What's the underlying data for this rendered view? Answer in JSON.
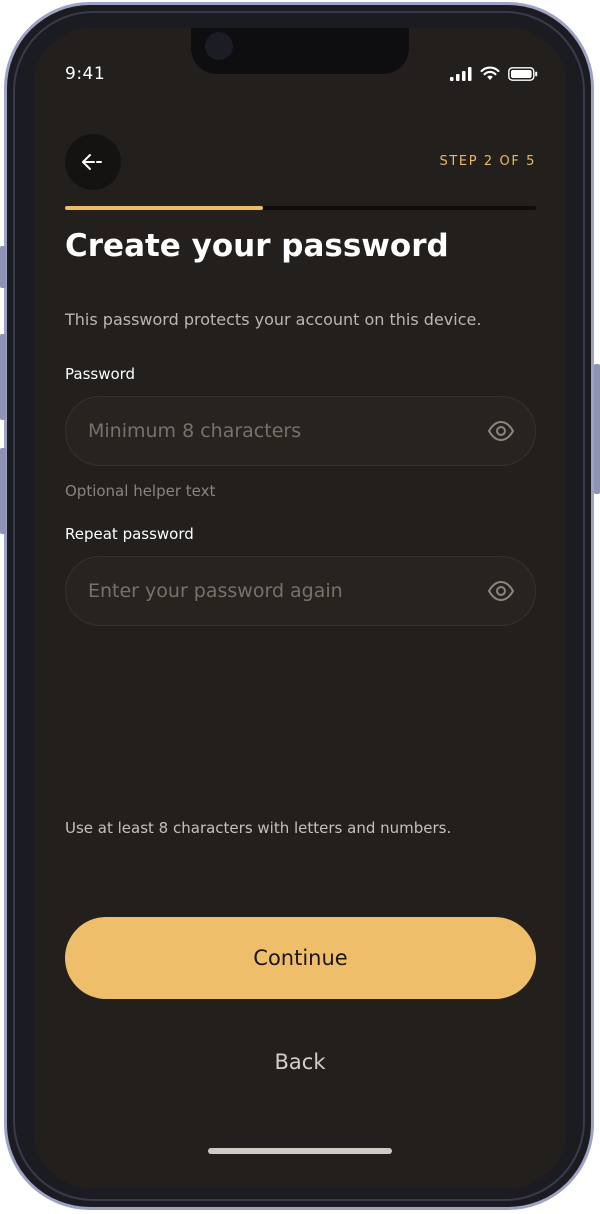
{
  "status_bar": {
    "time": "9:41"
  },
  "header": {
    "back_icon": "arrow-left-icon",
    "step_label": "STEP 2 OF 5",
    "progress": 0.42
  },
  "page": {
    "title": "Create your password",
    "subtitle": "This password protects your account on this device."
  },
  "password_field": {
    "label": "Password",
    "placeholder": "Minimum 8 characters",
    "value": "",
    "helper": "Optional helper text",
    "icon": "eye-icon"
  },
  "repeat_field": {
    "label": "Repeat password",
    "placeholder": "Enter your password again",
    "value": "",
    "icon": "eye-icon"
  },
  "hint": "Use at least 8 characters with letters and numbers.",
  "actions": {
    "continue_label": "Continue",
    "back_label": "Back"
  },
  "colors": {
    "background": "#231f1c",
    "accent": "#efbe6b",
    "step_label": "#e9b866"
  }
}
